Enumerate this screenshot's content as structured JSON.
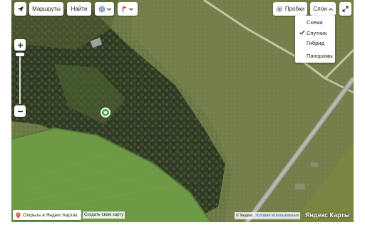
{
  "toolbar": {
    "locate_icon": "navigation-arrow-icon",
    "routes_label": "Маршруты",
    "find_label": "Найти",
    "layers_toggle_icon": "globe-icon",
    "flag_icon": "flag-icon",
    "traffic_label": "Пробки",
    "traffic_icon": "traffic-light-icon",
    "layers_label": "Слои",
    "fullscreen_icon": "expand-icon"
  },
  "layers_menu": {
    "items": [
      "Схема",
      "Спутник",
      "Гибрид",
      "Панорамы"
    ],
    "selected": "Спутник"
  },
  "zoom": {
    "plus_icon": "plus-icon",
    "minus_icon": "minus-icon"
  },
  "footer": {
    "open_in_app": "Открыть в Яндекс Картах",
    "create_map": "Создать свою карту",
    "copyright": "© Яндекс",
    "terms": "Условия использования",
    "brand": "Яндекс Карты"
  },
  "colors": {
    "accent_green": "#4caf50",
    "placemark_red": "#e53935",
    "link_blue": "#1a5fb4"
  }
}
